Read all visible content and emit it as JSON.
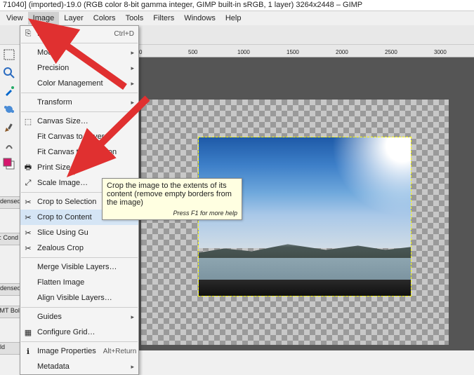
{
  "title": "71040] (imported)-19.0 (RGB color 8-bit gamma integer, GIMP built-in sRGB, 1 layer) 3264x2448 – GIMP",
  "menubar": {
    "view": "View",
    "image": "Image",
    "layer": "Layer",
    "colors": "Colors",
    "tools": "Tools",
    "filters": "Filters",
    "windows": "Windows",
    "help": "Help"
  },
  "ruler_marks": [
    "0",
    "500",
    "1000",
    "1500",
    "2000",
    "2500",
    "3000"
  ],
  "dropdown": {
    "duplicate": "Duplicate",
    "duplicate_accel": "Ctrl+D",
    "mode": "Mode",
    "precision": "Precision",
    "color_mgmt": "Color Management",
    "transform": "Transform",
    "canvas_size": "Canvas Size…",
    "fit_layers": "Fit Canvas to Layers",
    "fit_sel": "Fit Canvas to Selection",
    "print_size": "Print Size…",
    "scale": "Scale Image…",
    "crop_sel": "Crop to Selection",
    "crop_content": "Crop to Content",
    "slice": "Slice Using Gu",
    "zealous": "Zealous Crop",
    "merge": "Merge Visible Layers…",
    "flatten": "Flatten Image",
    "align": "Align Visible Layers…",
    "guides": "Guides",
    "grid": "Configure Grid…",
    "props": "Image Properties",
    "props_accel": "Alt+Return",
    "metadata": "Metadata"
  },
  "tooltip": {
    "text": "Crop the image to the extents of its content (remove empty borders from the image)",
    "help": "Press F1 for more help"
  },
  "docks": {
    "a": "ndensed",
    "b": "s: Cond",
    "c": "ndensed",
    "d": "i MT Bold,",
    "e": "old"
  }
}
